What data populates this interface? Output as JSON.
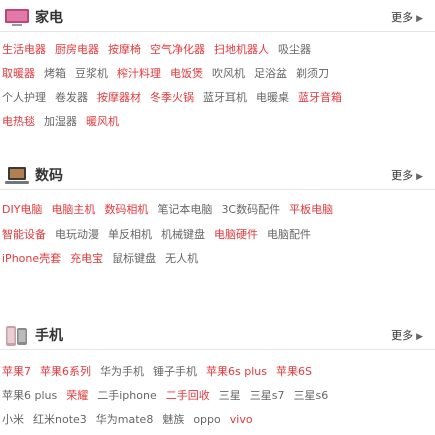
{
  "more_label": "更多",
  "sections": [
    {
      "key": "appliance",
      "title": "家电",
      "rows": [
        [
          {
            "label": "生活电器",
            "hot": true
          },
          {
            "label": "厨房电器",
            "hot": true
          },
          {
            "label": "按摩椅",
            "hot": true
          },
          {
            "label": "空气净化器",
            "hot": true
          },
          {
            "label": "扫地机器人",
            "hot": true
          },
          {
            "label": "吸尘器",
            "hot": false
          }
        ],
        [
          {
            "label": "取暖器",
            "hot": true
          },
          {
            "label": "烤箱",
            "hot": false
          },
          {
            "label": "豆浆机",
            "hot": false
          },
          {
            "label": "榨汁料理",
            "hot": true
          },
          {
            "label": "电饭煲",
            "hot": true
          },
          {
            "label": "吹风机",
            "hot": false
          },
          {
            "label": "足浴盆",
            "hot": false
          },
          {
            "label": "剃须刀",
            "hot": false
          }
        ],
        [
          {
            "label": "个人护理",
            "hot": false
          },
          {
            "label": "卷发器",
            "hot": false
          },
          {
            "label": "按摩器材",
            "hot": true
          },
          {
            "label": "冬季火锅",
            "hot": true
          },
          {
            "label": "蓝牙耳机",
            "hot": false
          },
          {
            "label": "电暖桌",
            "hot": false
          },
          {
            "label": "蓝牙音箱",
            "hot": true
          }
        ],
        [
          {
            "label": "电热毯",
            "hot": true
          },
          {
            "label": "加湿器",
            "hot": false
          },
          {
            "label": "暖风机",
            "hot": true
          }
        ]
      ]
    },
    {
      "key": "digital",
      "title": "数码",
      "rows": [
        [
          {
            "label": "DIY电脑",
            "hot": true
          },
          {
            "label": "电脑主机",
            "hot": true
          },
          {
            "label": "数码相机",
            "hot": true
          },
          {
            "label": "笔记本电脑",
            "hot": false
          },
          {
            "label": "3C数码配件",
            "hot": false
          },
          {
            "label": "平板电脑",
            "hot": true
          }
        ],
        [
          {
            "label": "智能设备",
            "hot": true
          },
          {
            "label": "电玩动漫",
            "hot": false
          },
          {
            "label": "单反相机",
            "hot": false
          },
          {
            "label": "机械键盘",
            "hot": false
          },
          {
            "label": "电脑硬件",
            "hot": true
          },
          {
            "label": "电脑配件",
            "hot": false
          }
        ],
        [
          {
            "label": "iPhone壳套",
            "hot": true
          },
          {
            "label": "充电宝",
            "hot": true
          },
          {
            "label": "鼠标键盘",
            "hot": false
          },
          {
            "label": "无人机",
            "hot": false
          }
        ]
      ]
    },
    {
      "key": "phone",
      "title": "手机",
      "rows": [
        [
          {
            "label": "苹果7",
            "hot": true
          },
          {
            "label": "苹果6系列",
            "hot": true
          },
          {
            "label": "华为手机",
            "hot": false
          },
          {
            "label": "锤子手机",
            "hot": false
          },
          {
            "label": "苹果6s plus",
            "hot": true
          },
          {
            "label": "苹果6S",
            "hot": true
          }
        ],
        [
          {
            "label": "苹果6 plus",
            "hot": false
          },
          {
            "label": "荣耀",
            "hot": true
          },
          {
            "label": "二手iphone",
            "hot": false
          },
          {
            "label": "二手回收",
            "hot": true
          },
          {
            "label": "三星",
            "hot": false
          },
          {
            "label": "三星s7",
            "hot": false
          },
          {
            "label": "三星s6",
            "hot": false
          }
        ],
        [
          {
            "label": "小米",
            "hot": false
          },
          {
            "label": "红米note3",
            "hot": false
          },
          {
            "label": "华为mate8",
            "hot": false
          },
          {
            "label": "魅族",
            "hot": false
          },
          {
            "label": "oppo",
            "hot": false
          },
          {
            "label": "vivo",
            "hot": true
          }
        ]
      ]
    }
  ]
}
